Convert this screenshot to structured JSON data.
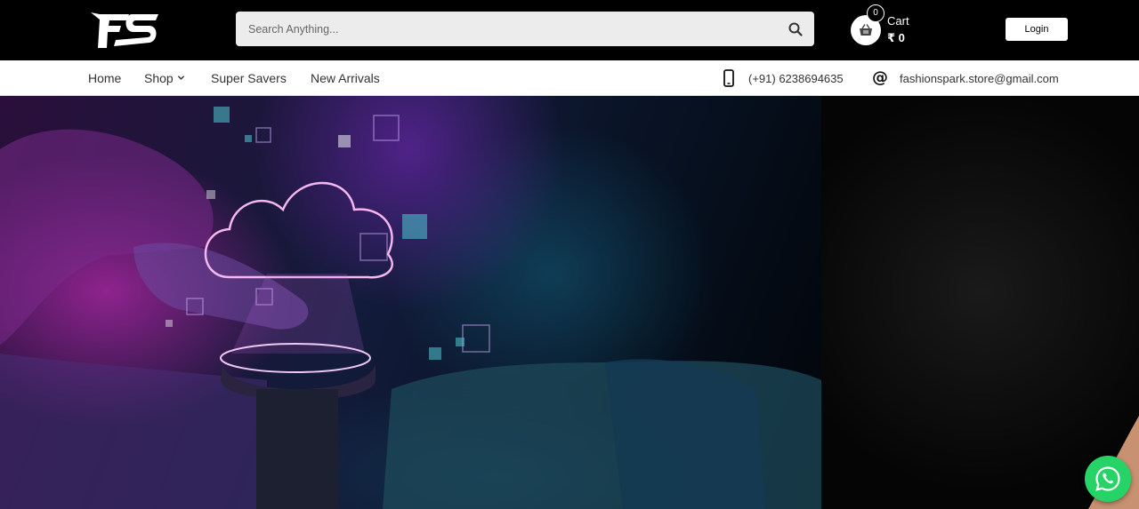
{
  "brand": {
    "logo_text": "FS"
  },
  "search": {
    "placeholder": "Search Anything...",
    "value": "",
    "icon": "search-icon"
  },
  "cart": {
    "count": "0",
    "label": "Cart",
    "total": "₹ 0",
    "icon": "basket-icon"
  },
  "auth": {
    "login_label": "Login"
  },
  "nav": {
    "items": [
      {
        "label": "Home"
      },
      {
        "label": "Shop",
        "has_dropdown": true
      },
      {
        "label": "Super Savers"
      },
      {
        "label": "New Arrivals"
      }
    ]
  },
  "contact": {
    "phone": "(+91) 6238694635",
    "phone_icon": "phone-icon",
    "email": "fashionspark.store@gmail.com",
    "email_icon": "at-icon"
  },
  "colors": {
    "header_bg": "#000000",
    "nav_bg": "#ffffff",
    "whatsapp": "#25d366"
  },
  "floating": {
    "whatsapp_icon": "whatsapp-icon"
  }
}
